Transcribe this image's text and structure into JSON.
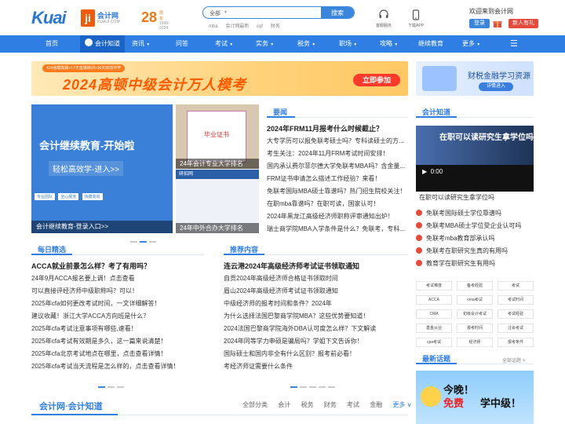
{
  "logo": {
    "kuai": "Kuai",
    "ji": "ji",
    "kjw": "会计网",
    "kjw_en": "KUAIJI.COM",
    "years": "28",
    "years_suffix": "周年",
    "years_range": "1996-2024"
  },
  "search": {
    "category": "全部",
    "button": "搜索",
    "hot": [
      "mba",
      "会计网最新",
      "cqf",
      "财务"
    ]
  },
  "tools": {
    "service": "客服服务",
    "app": "下载APP"
  },
  "user": {
    "welcome": "欢迎来到会计网",
    "login": "登录",
    "new_gift": "新人有礼"
  },
  "nav": {
    "items": [
      "首页",
      "会计知道",
      "资讯",
      "问答",
      "考试",
      "实务",
      "税务",
      "职场",
      "攻略",
      "继续教育",
      "更多"
    ],
    "active": "会计知道"
  },
  "banner": {
    "strip": "414道模拟题+17天直播特训+36天高效伴学",
    "headline": "2024高顿中级会计万人模考",
    "cta": "立即参加"
  },
  "sidead": {
    "title": "财税金融学习资源",
    "cta": "详情进入"
  },
  "slides": {
    "s1_headline": "会计继续教育-开始啦",
    "s1_sub": "轻松高效学-进入>>",
    "s1_chips": [
      "专业团队",
      "全心服务",
      "快捷高效"
    ],
    "s1_caption": "会计继续教育-登录入口>>",
    "s2_doc": "毕业证书",
    "s2_caption": "24年会计专业大学排名",
    "s3_header": "研招网",
    "s3_caption": "24年中外合办大学排名"
  },
  "yaowen": {
    "label": "要闻",
    "headline": "2024年FRM11月报考什么时候截止？",
    "items": [
      "大专学历可以报免联考硕士吗？专科读硕士的方...",
      "考生关注：2024年11月FRM考试时间安排！",
      "国内承认费尔菲尔德大学免联考MBA吗？含金量...",
      "FRM证书申请怎么描述工作经验？来看！",
      "免联考国际MBA硕士靠谱吗？热门招生院校关注！",
      "在职mba靠谱吗？在职可读，国家认可！",
      "2024年黑龙江高级经济师职称评审通知出炉！",
      "瑞士商学院MBA入学条件是什么？免联考，专科..."
    ]
  },
  "kjzd": {
    "label": "会计知道",
    "video_line1": "在职可以读研究生拿学位吗",
    "video_time": "0:00",
    "video_title": "在职可以读研究生拿学位吗",
    "items": [
      "免联考国际硕士学位靠谱吗",
      "免联考MBA硕士学位受企业认可吗",
      "免联考mba教育部承认吗",
      "免联考在职研究生真的有用吗",
      "教育学在职研究生有用吗"
    ]
  },
  "tags": [
    "考试难度",
    "备考经验",
    "考试",
    "ACCA",
    "cma考试",
    "考试时间",
    "CMA",
    "初级会计考试",
    "考试经验",
    "基金从业",
    "报考时间",
    "注会考试",
    "cpa考试",
    "经济师",
    "报考条件"
  ],
  "daily": {
    "label": "每日精选",
    "headline": "ACCA就业前景怎么样？考了有用吗？",
    "items": [
      "24年9月ACCA报名要上调！点击查看",
      "可以直接评经济师中级职称吗？可以！",
      "2025年cfa如何更改考试时间，一文详细解答！",
      "建议收藏！浙江大学ACCA方向班是什么？",
      "2025年cfa考试注意事项有哪些,速看！",
      "2025年cfa考试有效期是多久，这一篇来说清楚！",
      "2025年cfa北京考试地点在哪里，点击查看详情！",
      "2025年cfa考试当天流程是怎么样的，点击查看详情！"
    ]
  },
  "recommend": {
    "label": "推荐内容",
    "headline": "连云港2024年高级经济师考试证书领取通知",
    "items": [
      "自贡2024年高级经济师合格证书领取时间",
      "眉山2024年高级经济师考试证书领取通知",
      "中级经济师的报考时间和条件？2024年",
      "为什么选择法国巴黎商学院MBA？这些优势要知道！",
      "2024法国巴黎商学院海外DBA认可度怎么样？下文解读",
      "2024年同等学力申硕是骗局吗？学姐下文告诉你！",
      "国际硕士和国内非全有什么区别？报考前必看！",
      "考经济师证需要什么条件"
    ]
  },
  "hot": {
    "label": "最新话题",
    "more": "全部话题 >",
    "ad_line1": "今晚！",
    "ad_hl": "免费",
    "ad_rest": "学中级！"
  },
  "footer": {
    "title": "会计网·会计知道",
    "tabs": [
      "全部分类",
      "会计",
      "税务",
      "财务",
      "考试",
      "金融"
    ],
    "more": "更多 ∨"
  },
  "colors": {
    "brand": "#2f7ee4",
    "accent": "#e64a3c",
    "orange": "#f07814"
  }
}
